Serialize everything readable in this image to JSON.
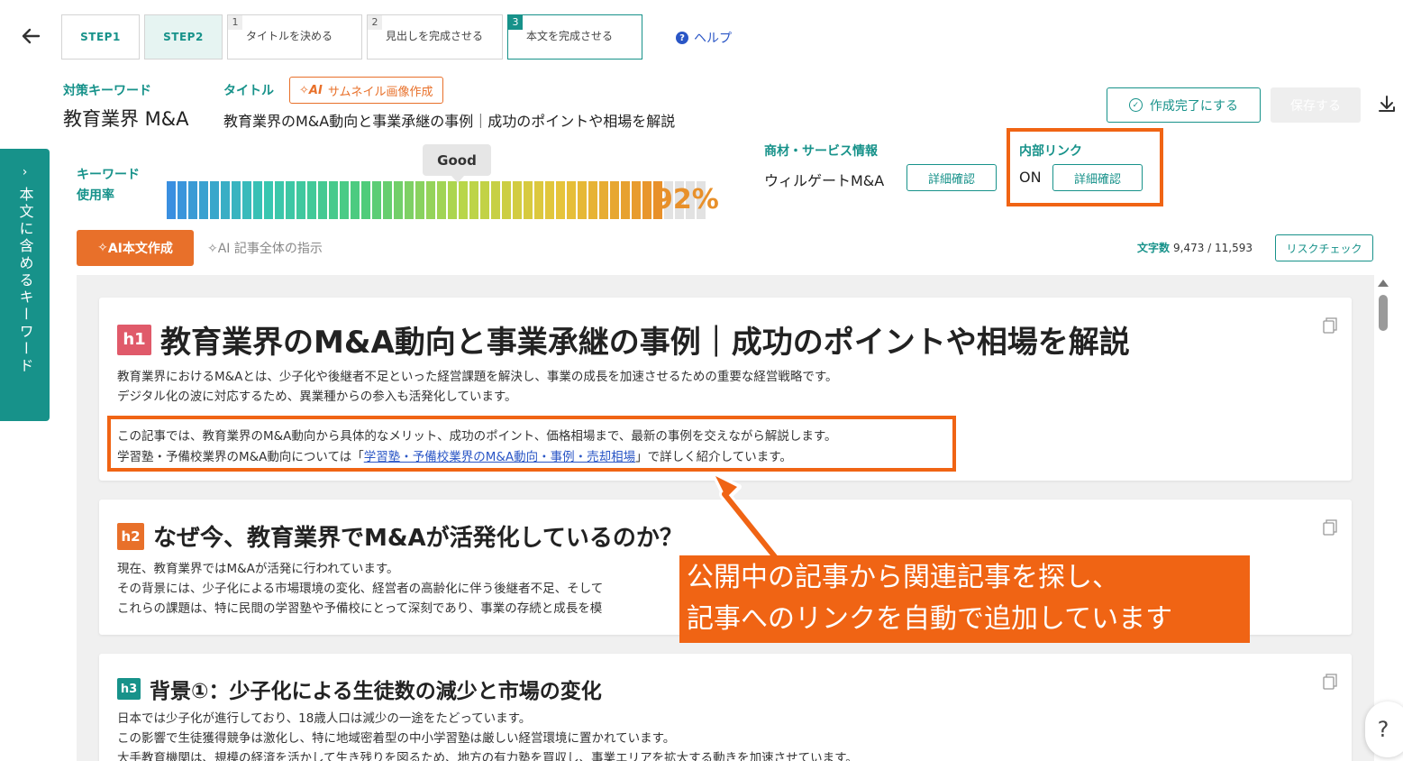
{
  "nav": {
    "step1": "STEP1",
    "step2": "STEP2",
    "substeps": [
      {
        "num": "1",
        "label": "タイトルを決める"
      },
      {
        "num": "2",
        "label": "見出しを完成させる"
      },
      {
        "num": "3",
        "label": "本文を完成させる"
      }
    ],
    "help": "ヘルプ"
  },
  "keyword": {
    "label": "対策キーワード",
    "value": "教育業界 M&A"
  },
  "title": {
    "label": "タイトル",
    "thumbnail_button": "サムネイル画像作成",
    "ai_badge": "AI",
    "value": "教育業界のM&A動向と事業承継の事例｜成功のポイントや相場を解説"
  },
  "actions": {
    "complete": "作成完了にする",
    "save": "保存する"
  },
  "usage": {
    "label_line1": "キーワード",
    "label_line2": "使用率",
    "tooltip": "Good",
    "percent_text": "92%",
    "fill_fraction": 0.92,
    "segments_total": 50,
    "color_stops": [
      "#3a8fe0",
      "#38c6b0",
      "#4fcc7a",
      "#b8d64a",
      "#e6c43a",
      "#e8902a"
    ],
    "empty_color": "#e2e2e2"
  },
  "product": {
    "label": "商材・サービス情報",
    "value": "ウィルゲートM&A",
    "detail": "詳細確認"
  },
  "internal_link": {
    "label": "内部リンク",
    "value": "ON",
    "detail": "詳細確認"
  },
  "ai_write": {
    "button": "AI本文作成",
    "instruction": "記事全体の指示"
  },
  "wordcount": {
    "label": "文字数",
    "value": "9,473 / 11,593"
  },
  "risk_check": "リスクチェック",
  "side_tab": {
    "label": "本文に含めるキーワード"
  },
  "sections": {
    "h1": {
      "tag": "h1",
      "heading": "教育業界のM&A動向と事業承継の事例｜成功のポイントや相場を解説",
      "p1": "教育業界におけるM&Aとは、少子化や後継者不足といった経営課題を解決し、事業の成長を加速させるための重要な経営戦略です。",
      "p2": "デジタル化の波に対応するため、異業種からの参入も活発化しています。",
      "p3": "この記事では、教育業界のM&A動向から具体的なメリット、成功のポイント、価格相場まで、最新の事例を交えながら解説します。",
      "p4_before": "学習塾・予備校業界のM&A動向については「",
      "p4_link": "学習塾・予備校業界のM&A動向・事例・売却相場",
      "p4_after": "」で詳しく紹介しています。"
    },
    "h2": {
      "tag": "h2",
      "heading": "なぜ今、教育業界でM&Aが活発化しているのか？",
      "p1": "現在、教育業界ではM&Aが活発に行われています。",
      "p2": "その背景には、少子化による市場環境の変化、経営者の高齢化に伴う後継者不足、そして",
      "p3": "これらの課題は、特に民間の学習塾や予備校にとって深刻であり、事業の存続と成長を模"
    },
    "h3": {
      "tag": "h3",
      "heading": "背景①：少子化による生徒数の減少と市場の変化",
      "p1": "日本では少子化が進行しており、18歳人口は減少の一途をたどっています。",
      "p2": "この影響で生徒獲得競争は激化し、特に地域密着型の中小学習塾は厳しい経営環境に置かれています。",
      "p3": "大手教育機関は、規模の経済を活かして生き残りを図るため、地方の有力塾を買収し、事業エリアを拡大する動きを加速させています。"
    }
  },
  "callout": {
    "line1": "公開中の記事から関連記事を探し、",
    "line2": "記事へのリンクを自動で追加しています"
  },
  "help_fab": "?"
}
